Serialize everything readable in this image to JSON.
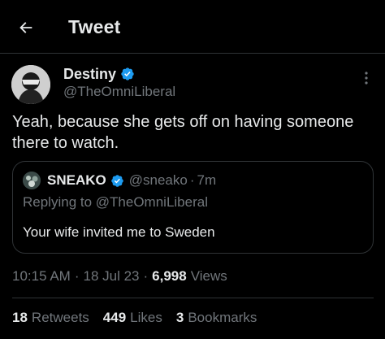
{
  "header": {
    "title": "Tweet",
    "back_icon": "arrow-left-icon"
  },
  "tweet": {
    "author_name": "Destiny",
    "author_handle": "@TheOmniLiberal",
    "verified": true,
    "text": "Yeah, because she gets off on having someone there to watch.",
    "time": "10:15 AM",
    "date": "18 Jul 23",
    "views_count": "6,998",
    "views_label": "Views"
  },
  "quote": {
    "author_name": "SNEAKO",
    "author_handle": "@sneako",
    "separator": "·",
    "time_ago": "7m",
    "replying_to": "Replying to @TheOmniLiberal",
    "text": "Your wife invited me to Sweden",
    "verified": true
  },
  "meta": {
    "separator": "·"
  },
  "stats": {
    "retweets_count": "18",
    "retweets_label": "Retweets",
    "likes_count": "449",
    "likes_label": "Likes",
    "bookmarks_count": "3",
    "bookmarks_label": "Bookmarks"
  },
  "colors": {
    "background": "#000000",
    "text": "#e7e9ea",
    "secondary_text": "#71767b",
    "border": "#2f3336",
    "verified_blue": "#1d9bf0"
  }
}
